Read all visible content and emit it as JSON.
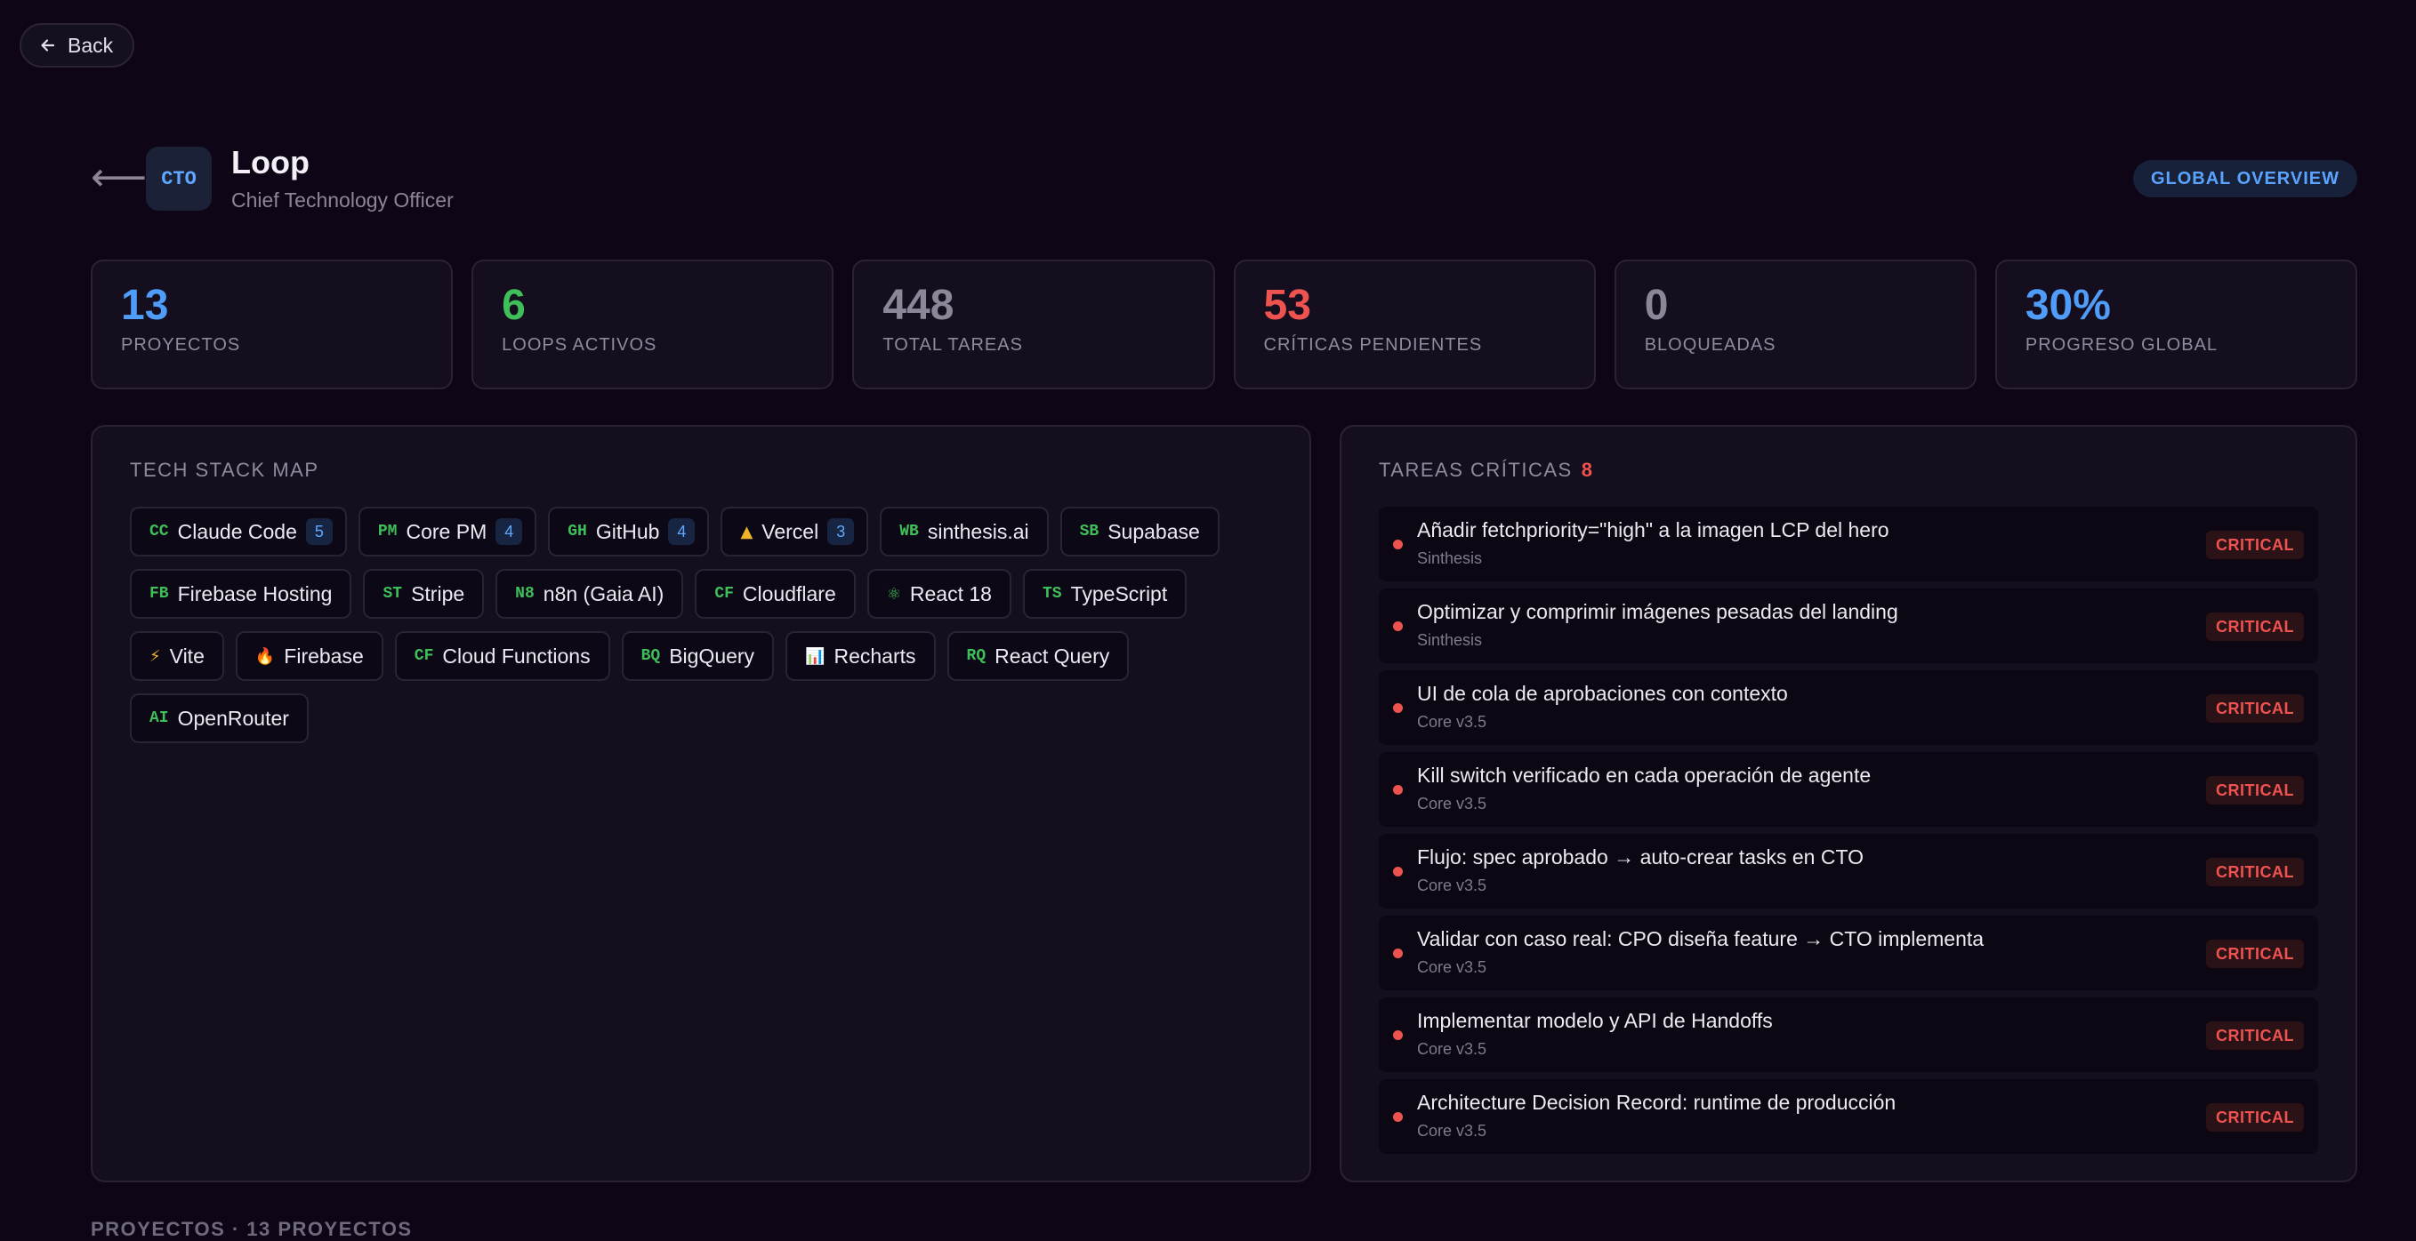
{
  "nav": {
    "back_label": "Back"
  },
  "header": {
    "back_arrow": "⟵",
    "role_badge": "CTO",
    "title": "Loop",
    "subtitle": "Chief Technology Officer",
    "overview_label": "GLOBAL OVERVIEW"
  },
  "stats": [
    {
      "value": "13",
      "label": "PROYECTOS",
      "color": "#4f9cf9"
    },
    {
      "value": "6",
      "label": "LOOPS ACTIVOS",
      "color": "#3fbf59"
    },
    {
      "value": "448",
      "label": "TOTAL TAREAS",
      "color": "#8b8798"
    },
    {
      "value": "53",
      "label": "CRÍTICAS PENDIENTES",
      "color": "#ef5350"
    },
    {
      "value": "0",
      "label": "BLOQUEADAS",
      "color": "#8b8798"
    },
    {
      "value": "30%",
      "label": "PROGRESO GLOBAL",
      "color": "#4f9cf9"
    }
  ],
  "tech_stack": {
    "title": "TECH STACK MAP",
    "items": [
      {
        "abbr": "CC",
        "name": "Claude Code",
        "count": "5"
      },
      {
        "abbr": "PM",
        "name": "Core PM",
        "count": "4"
      },
      {
        "abbr": "GH",
        "name": "GitHub",
        "count": "4"
      },
      {
        "abbr": "▲",
        "name": "Vercel",
        "count": "3",
        "abbr_color": "#f0b429",
        "glyph": true
      },
      {
        "abbr": "WB",
        "name": "sinthesis.ai"
      },
      {
        "abbr": "SB",
        "name": "Supabase"
      },
      {
        "abbr": "FB",
        "name": "Firebase Hosting"
      },
      {
        "abbr": "ST",
        "name": "Stripe"
      },
      {
        "abbr": "N8",
        "name": "n8n (Gaia AI)"
      },
      {
        "abbr": "CF",
        "name": "Cloudflare"
      },
      {
        "abbr": "⚛",
        "name": "React 18",
        "glyph": true
      },
      {
        "abbr": "TS",
        "name": "TypeScript"
      },
      {
        "abbr": "⚡",
        "name": "Vite",
        "abbr_color": "#f0b429",
        "glyph": true
      },
      {
        "abbr": "🔥",
        "name": "Firebase",
        "abbr_color": "#ff6b2c",
        "glyph": true
      },
      {
        "abbr": "CF",
        "name": "Cloud Functions"
      },
      {
        "abbr": "BQ",
        "name": "BigQuery"
      },
      {
        "abbr": "📊",
        "name": "Recharts",
        "abbr_color": "#5ea8ff",
        "glyph": true
      },
      {
        "abbr": "RQ",
        "name": "React Query"
      },
      {
        "abbr": "AI",
        "name": "OpenRouter"
      }
    ]
  },
  "critical_tasks": {
    "title": "TAREAS CRÍTICAS",
    "count": "8",
    "items": [
      {
        "title": "Añadir fetchpriority=\"high\" a la imagen LCP del hero",
        "project": "Sinthesis",
        "severity": "CRITICAL"
      },
      {
        "title": "Optimizar y comprimir imágenes pesadas del landing",
        "project": "Sinthesis",
        "severity": "CRITICAL"
      },
      {
        "title": "UI de cola de aprobaciones con contexto",
        "project": "Core v3.5",
        "severity": "CRITICAL"
      },
      {
        "title": "Kill switch verificado en cada operación de agente",
        "project": "Core v3.5",
        "severity": "CRITICAL"
      },
      {
        "title": "Flujo: spec aprobado → auto-crear tasks en CTO",
        "project": "Core v3.5",
        "severity": "CRITICAL"
      },
      {
        "title": "Validar con caso real: CPO diseña feature → CTO implementa",
        "project": "Core v3.5",
        "severity": "CRITICAL"
      },
      {
        "title": "Implementar modelo y API de Handoffs",
        "project": "Core v3.5",
        "severity": "CRITICAL"
      },
      {
        "title": "Architecture Decision Record: runtime de producción",
        "project": "Core v3.5",
        "severity": "CRITICAL"
      }
    ]
  },
  "projects_section": {
    "title": "PROYECTOS · 13 PROYECTOS"
  }
}
